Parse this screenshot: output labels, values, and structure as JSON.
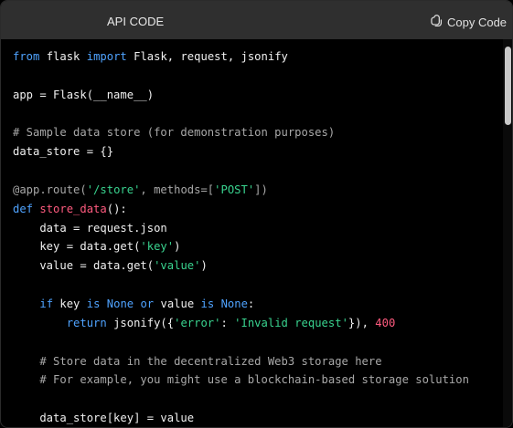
{
  "header": {
    "title": "API CODE",
    "copy_label": "Copy Code",
    "copy_icon": "copy-icon"
  },
  "code": {
    "language": "python",
    "lines": [
      [
        {
          "t": "from",
          "c": "kw"
        },
        {
          "t": " flask "
        },
        {
          "t": "import",
          "c": "kw"
        },
        {
          "t": " Flask, request, jsonify"
        }
      ],
      [],
      [
        {
          "t": "app = Flask(__name__)"
        }
      ],
      [],
      [
        {
          "t": "# Sample data store (for demonstration purposes)",
          "c": "cm"
        }
      ],
      [
        {
          "t": "data_store = {}"
        }
      ],
      [],
      [
        {
          "t": "@app.route(",
          "c": "dec"
        },
        {
          "t": "'/store'",
          "c": "str"
        },
        {
          "t": ", methods=[",
          "c": "dec"
        },
        {
          "t": "'POST'",
          "c": "str"
        },
        {
          "t": "])",
          "c": "dec"
        }
      ],
      [
        {
          "t": "def",
          "c": "kw"
        },
        {
          "t": " "
        },
        {
          "t": "store_data",
          "c": "fn"
        },
        {
          "t": "():"
        }
      ],
      [
        {
          "t": "    data = request.json"
        }
      ],
      [
        {
          "t": "    key = data.get("
        },
        {
          "t": "'key'",
          "c": "str"
        },
        {
          "t": ")"
        }
      ],
      [
        {
          "t": "    value = data.get("
        },
        {
          "t": "'value'",
          "c": "str"
        },
        {
          "t": ")"
        }
      ],
      [],
      [
        {
          "t": "    "
        },
        {
          "t": "if",
          "c": "kw"
        },
        {
          "t": " key "
        },
        {
          "t": "is",
          "c": "kw"
        },
        {
          "t": " "
        },
        {
          "t": "None",
          "c": "kw"
        },
        {
          "t": " "
        },
        {
          "t": "or",
          "c": "kw"
        },
        {
          "t": " value "
        },
        {
          "t": "is",
          "c": "kw"
        },
        {
          "t": " "
        },
        {
          "t": "None",
          "c": "kw"
        },
        {
          "t": ":"
        }
      ],
      [
        {
          "t": "        "
        },
        {
          "t": "return",
          "c": "kw"
        },
        {
          "t": " jsonify({"
        },
        {
          "t": "'error'",
          "c": "str"
        },
        {
          "t": ": "
        },
        {
          "t": "'Invalid request'",
          "c": "str"
        },
        {
          "t": "}), "
        },
        {
          "t": "400",
          "c": "num"
        }
      ],
      [],
      [
        {
          "t": "    # Store data in the decentralized Web3 storage here",
          "c": "cm"
        }
      ],
      [
        {
          "t": "    # For example, you might use a blockchain-based storage solution",
          "c": "cm"
        }
      ],
      [],
      [
        {
          "t": "    data_store[key] = value"
        }
      ],
      [
        {
          "t": ""
        }
      ]
    ]
  }
}
